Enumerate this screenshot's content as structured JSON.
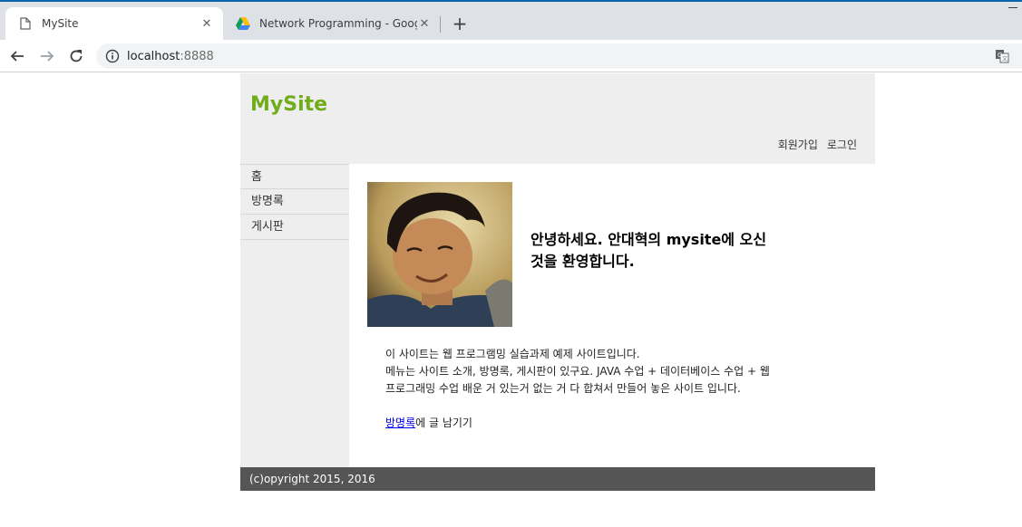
{
  "browser": {
    "tabs": [
      {
        "title": "MySite",
        "active": true,
        "icon": "page-icon"
      },
      {
        "title": "Network Programming - Google",
        "active": false,
        "icon": "google-drive-icon"
      }
    ],
    "url_host": "localhost",
    "url_port": ":8888"
  },
  "site": {
    "title": "MySite",
    "header_links": {
      "join": "회원가입",
      "login": "로그인"
    },
    "nav": [
      "홈",
      "방명록",
      "게시판"
    ],
    "welcome_line1": "안녕하세요. 안대혁의 mysite에 오신",
    "welcome_line2": "것을 환영합니다.",
    "desc_line1": "이 사이트는 웹 프로그램밍 실습과제 예제 사이트입니다.",
    "desc_line2": "메뉴는 사이트 소개, 방명록, 게시판이 있구요. JAVA 수업 + 데이터베이스 수업 + 웹",
    "desc_line3": "프로그래밍 수업 배운 거 있는거 없는 거 다 합쳐서 만들어 놓은 사이트 입니다.",
    "guestbook_link": "방명록",
    "guestbook_suffix": "에 글 남기기",
    "footer": "(c)opyright 2015, 2016"
  },
  "colors": {
    "brand": "#71ad1b",
    "header_bg": "#eeeeee",
    "footer_bg": "#555555",
    "link": "#0000ee"
  }
}
